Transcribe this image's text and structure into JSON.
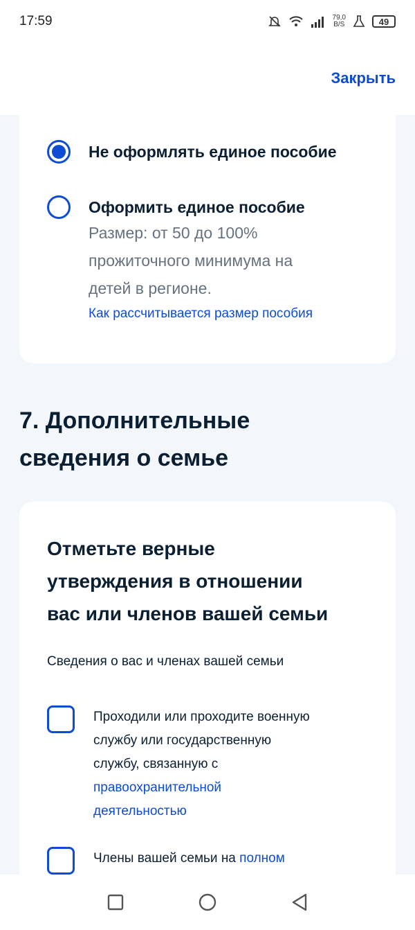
{
  "status_bar": {
    "time": "17:59",
    "net_speed_value": "79,0",
    "net_speed_unit": "B/S",
    "battery": "49",
    "icons": [
      "mute-icon",
      "wifi-icon",
      "signal-icon",
      "flask-icon",
      "battery-icon"
    ]
  },
  "header": {
    "close_label": "Закрыть"
  },
  "benefit_options": [
    {
      "label": "Не оформлять единое пособие",
      "selected": true
    },
    {
      "label": "Оформить единое пособие",
      "selected": false,
      "description": [
        "Размер: от 50 до 100%",
        "прожиточного минимума на",
        "детей в регионе."
      ],
      "link": "Как рассчитывается размер пособия"
    }
  ],
  "section": {
    "title_line1": "7. Дополнительные",
    "title_line2": "сведения о семье"
  },
  "family_card": {
    "title_lines": [
      "Отметьте верные",
      "утверждения в отношении",
      "вас или членов вашей семьи"
    ],
    "subtitle": "Сведения о вас и членах вашей семьи",
    "checkboxes": [
      {
        "lines": [
          "Проходили или проходите военную",
          "службу или государственную",
          "службу, связанную с"
        ],
        "link_lines": [
          "правоохранительной",
          "деятельностью"
        ],
        "checked": false
      },
      {
        "text": "Члены вашей семьи на ",
        "link": "полном",
        "checked": false
      }
    ]
  },
  "nav_bar": {
    "buttons": [
      "recent-apps-button",
      "home-button",
      "back-button"
    ]
  },
  "colors": {
    "accent": "#0d4cd3",
    "text": "#0b1f33",
    "muted": "#66727f",
    "background": "#f3f6fb"
  }
}
